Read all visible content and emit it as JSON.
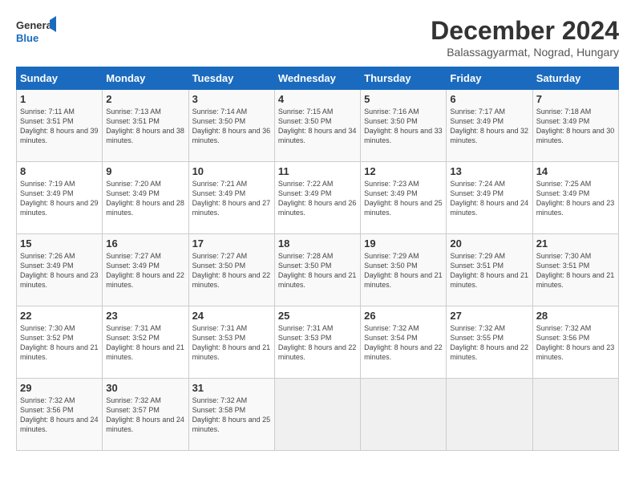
{
  "header": {
    "logo_line1": "General",
    "logo_line2": "Blue",
    "month": "December 2024",
    "location": "Balassagyarmat, Nograd, Hungary"
  },
  "days_of_week": [
    "Sunday",
    "Monday",
    "Tuesday",
    "Wednesday",
    "Thursday",
    "Friday",
    "Saturday"
  ],
  "weeks": [
    [
      {
        "day": 1,
        "sunrise": "7:11 AM",
        "sunset": "3:51 PM",
        "daylight": "8 hours and 39 minutes."
      },
      {
        "day": 2,
        "sunrise": "7:13 AM",
        "sunset": "3:51 PM",
        "daylight": "8 hours and 38 minutes."
      },
      {
        "day": 3,
        "sunrise": "7:14 AM",
        "sunset": "3:50 PM",
        "daylight": "8 hours and 36 minutes."
      },
      {
        "day": 4,
        "sunrise": "7:15 AM",
        "sunset": "3:50 PM",
        "daylight": "8 hours and 34 minutes."
      },
      {
        "day": 5,
        "sunrise": "7:16 AM",
        "sunset": "3:50 PM",
        "daylight": "8 hours and 33 minutes."
      },
      {
        "day": 6,
        "sunrise": "7:17 AM",
        "sunset": "3:49 PM",
        "daylight": "8 hours and 32 minutes."
      },
      {
        "day": 7,
        "sunrise": "7:18 AM",
        "sunset": "3:49 PM",
        "daylight": "8 hours and 30 minutes."
      }
    ],
    [
      {
        "day": 8,
        "sunrise": "7:19 AM",
        "sunset": "3:49 PM",
        "daylight": "8 hours and 29 minutes."
      },
      {
        "day": 9,
        "sunrise": "7:20 AM",
        "sunset": "3:49 PM",
        "daylight": "8 hours and 28 minutes."
      },
      {
        "day": 10,
        "sunrise": "7:21 AM",
        "sunset": "3:49 PM",
        "daylight": "8 hours and 27 minutes."
      },
      {
        "day": 11,
        "sunrise": "7:22 AM",
        "sunset": "3:49 PM",
        "daylight": "8 hours and 26 minutes."
      },
      {
        "day": 12,
        "sunrise": "7:23 AM",
        "sunset": "3:49 PM",
        "daylight": "8 hours and 25 minutes."
      },
      {
        "day": 13,
        "sunrise": "7:24 AM",
        "sunset": "3:49 PM",
        "daylight": "8 hours and 24 minutes."
      },
      {
        "day": 14,
        "sunrise": "7:25 AM",
        "sunset": "3:49 PM",
        "daylight": "8 hours and 23 minutes."
      }
    ],
    [
      {
        "day": 15,
        "sunrise": "7:26 AM",
        "sunset": "3:49 PM",
        "daylight": "8 hours and 23 minutes."
      },
      {
        "day": 16,
        "sunrise": "7:27 AM",
        "sunset": "3:49 PM",
        "daylight": "8 hours and 22 minutes."
      },
      {
        "day": 17,
        "sunrise": "7:27 AM",
        "sunset": "3:50 PM",
        "daylight": "8 hours and 22 minutes."
      },
      {
        "day": 18,
        "sunrise": "7:28 AM",
        "sunset": "3:50 PM",
        "daylight": "8 hours and 21 minutes."
      },
      {
        "day": 19,
        "sunrise": "7:29 AM",
        "sunset": "3:50 PM",
        "daylight": "8 hours and 21 minutes."
      },
      {
        "day": 20,
        "sunrise": "7:29 AM",
        "sunset": "3:51 PM",
        "daylight": "8 hours and 21 minutes."
      },
      {
        "day": 21,
        "sunrise": "7:30 AM",
        "sunset": "3:51 PM",
        "daylight": "8 hours and 21 minutes."
      }
    ],
    [
      {
        "day": 22,
        "sunrise": "7:30 AM",
        "sunset": "3:52 PM",
        "daylight": "8 hours and 21 minutes."
      },
      {
        "day": 23,
        "sunrise": "7:31 AM",
        "sunset": "3:52 PM",
        "daylight": "8 hours and 21 minutes."
      },
      {
        "day": 24,
        "sunrise": "7:31 AM",
        "sunset": "3:53 PM",
        "daylight": "8 hours and 21 minutes."
      },
      {
        "day": 25,
        "sunrise": "7:31 AM",
        "sunset": "3:53 PM",
        "daylight": "8 hours and 22 minutes."
      },
      {
        "day": 26,
        "sunrise": "7:32 AM",
        "sunset": "3:54 PM",
        "daylight": "8 hours and 22 minutes."
      },
      {
        "day": 27,
        "sunrise": "7:32 AM",
        "sunset": "3:55 PM",
        "daylight": "8 hours and 22 minutes."
      },
      {
        "day": 28,
        "sunrise": "7:32 AM",
        "sunset": "3:56 PM",
        "daylight": "8 hours and 23 minutes."
      }
    ],
    [
      {
        "day": 29,
        "sunrise": "7:32 AM",
        "sunset": "3:56 PM",
        "daylight": "8 hours and 24 minutes."
      },
      {
        "day": 30,
        "sunrise": "7:32 AM",
        "sunset": "3:57 PM",
        "daylight": "8 hours and 24 minutes."
      },
      {
        "day": 31,
        "sunrise": "7:32 AM",
        "sunset": "3:58 PM",
        "daylight": "8 hours and 25 minutes."
      },
      null,
      null,
      null,
      null
    ]
  ]
}
